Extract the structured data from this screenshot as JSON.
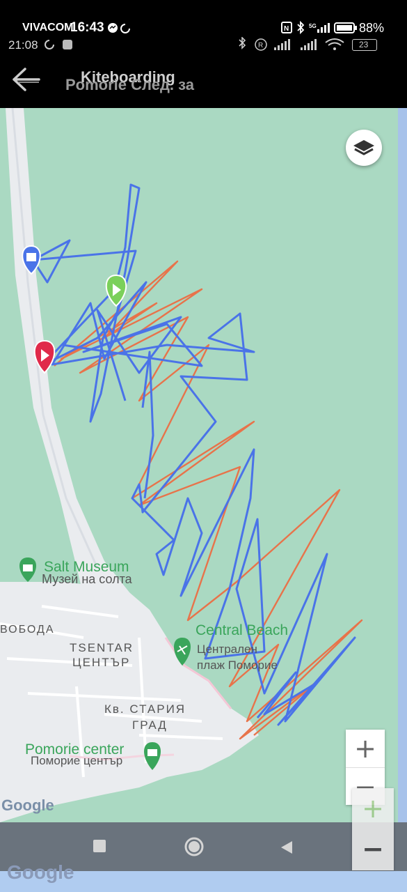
{
  "status_bar": {
    "carrier": "VIVACOM",
    "time_main": "16:43",
    "battery_main": "88%",
    "time_inner": "21:08",
    "battery_inner": "23"
  },
  "header": {
    "title": "Kiteboarding",
    "subtitle": "Pomorie След. за"
  },
  "map": {
    "labels": {
      "salt_museum": "Salt Museum",
      "salt_museum_bg": "Музей на солта",
      "svoboda": "ВОБОДА",
      "tsentar": "TSENTAR",
      "tsentar_bg": "ЦЕНТЪР",
      "central_beach": "Central Beach",
      "central_beach_bg_1": "Централен",
      "central_beach_bg_2": "плаж Поморие",
      "kv_stariya": "Кв. СТАРИЯ",
      "grad": "ГРАД",
      "pomorie_center": "Pomorie center",
      "pomorie_center_bg": "Поморие център"
    },
    "google_logo": "Google",
    "zoom_in": "+",
    "zoom_out": "−",
    "colors": {
      "water": "#aad9c2",
      "land": "#eaecef",
      "track_blue": "#4a73e8",
      "track_orange": "#e8734a",
      "poi_green": "#3aa55b",
      "marker_blue": "#4a73e8",
      "marker_green": "#7bd05a",
      "marker_red": "#e02a4a"
    }
  },
  "nav": {
    "recent_icon": "square-icon",
    "home_icon": "circle-icon",
    "back_icon": "triangle-icon"
  }
}
